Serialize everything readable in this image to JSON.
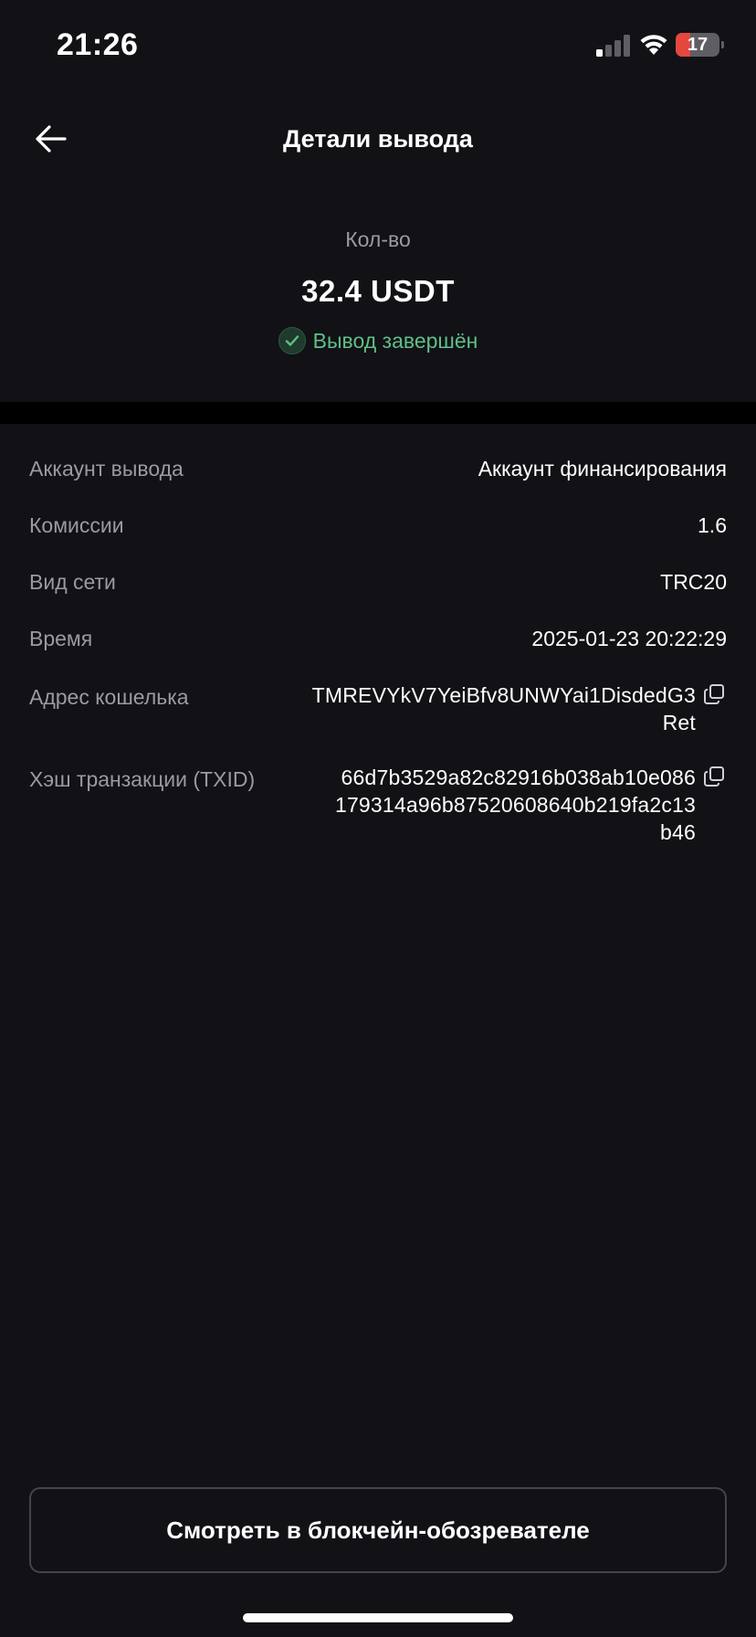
{
  "status_bar": {
    "time": "21:26",
    "battery_level": "17",
    "battery_fraction": 0.17,
    "battery_color": "#e5473f"
  },
  "header": {
    "title": "Детали вывода",
    "back_icon": "arrow-left-icon"
  },
  "amount": {
    "label": "Кол-во",
    "value": "32.4 USDT",
    "status_text": "Вывод завершён",
    "status_icon": "check-circle-icon",
    "status_color": "#5fbf86"
  },
  "details": {
    "account": {
      "label": "Аккаунт вывода",
      "value": "Аккаунт финансирования"
    },
    "fees": {
      "label": "Комиссии",
      "value": "1.6"
    },
    "network": {
      "label": "Вид сети",
      "value": "TRC20"
    },
    "time": {
      "label": "Время",
      "value": "2025-01-23 20:22:29"
    },
    "wallet": {
      "label": "Адрес кошелька",
      "value_line1": "TMREVYkV7YeiBfv8UNWYai1DisdedG3",
      "value_line2": "Ret",
      "copy_icon": "copy-icon"
    },
    "txid": {
      "label": "Хэш транзакции (TXID)",
      "value_line1": "66d7b3529a82c82916b038ab10e086",
      "value_line2": "179314a96b87520608640b219fa2c13",
      "value_line3": "b46",
      "copy_icon": "copy-icon"
    }
  },
  "explorer_button": {
    "label": "Смотреть в блокчейн-обозревателе"
  },
  "colors": {
    "background": "#111116",
    "label_gray": "#9a9aa2",
    "button_border": "#44444c"
  }
}
